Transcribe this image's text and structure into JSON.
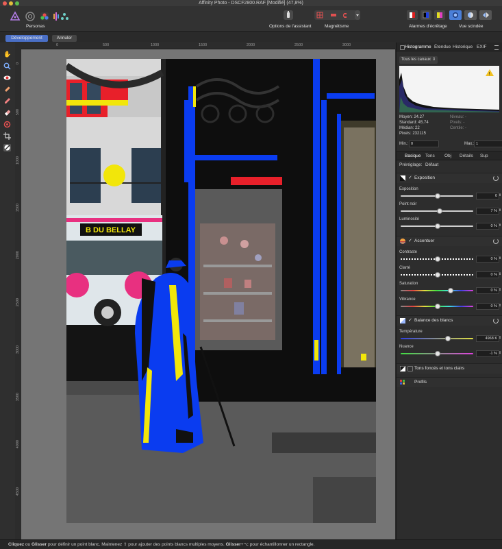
{
  "window": {
    "title": "Affinity Photo - DSCF2800.RAF [Modifié] (47,8%)"
  },
  "toolbar": {
    "personas_label": "Personas",
    "assistant_label": "Options de l'assistant",
    "snapping_label": "Magnétisme",
    "clipping_label": "Alarmes d'écrêtage",
    "split_label": "Vue scindée"
  },
  "persona_buttons": {
    "develop": "Développement",
    "cancel": "Annuler"
  },
  "ruler": {
    "h_ticks": [
      "0",
      "500",
      "1000",
      "1500",
      "2000",
      "2500",
      "3000"
    ],
    "v_ticks": [
      "0",
      "500",
      "1000",
      "1500",
      "2000",
      "2500",
      "3000",
      "3500",
      "4000",
      "4500"
    ]
  },
  "panel_tabs": [
    "Histogramme",
    "Étendue",
    "Historique",
    "EXIF"
  ],
  "histogram": {
    "channel_select": "Tous les canaux",
    "moyen": "Moyen: 24.27",
    "standard": "Standard: 45.74",
    "median": "Médian: 22",
    "pixels": "Pixels: 232115",
    "niveau": "Niveau: -",
    "pixels_r": "Pixels: -",
    "centile": "Centile: -",
    "min_label": "Min.:",
    "min_value": "0",
    "max_label": "Max.:",
    "max_value": "1"
  },
  "develop_tabs": [
    "Basique",
    "Tons",
    "Obj",
    "Détails",
    "Sup"
  ],
  "preset": {
    "label": "Préréglage:",
    "value": "Défaut"
  },
  "sections": {
    "exposure": {
      "title": "Exposition",
      "sliders": [
        {
          "label": "Exposition",
          "value": "0",
          "level": 0.5
        },
        {
          "label": "Point noir",
          "value": "7 %",
          "level": 0.53
        },
        {
          "label": "Luminosité",
          "value": "0 %",
          "level": 0.5
        }
      ]
    },
    "enhance": {
      "title": "Accentuer",
      "sliders": [
        {
          "label": "Contraste",
          "value": "0 %",
          "level": 0.5
        },
        {
          "label": "Clarté",
          "value": "0 %",
          "level": 0.5
        },
        {
          "label": "Saturation",
          "value": "0 %",
          "level": 0.68
        },
        {
          "label": "Vibrance",
          "value": "0 %",
          "level": 0.5
        }
      ]
    },
    "white_balance": {
      "title": "Balance des blancs",
      "sliders": [
        {
          "label": "Température",
          "value": "4968 K",
          "level": 0.64
        },
        {
          "label": "Nuance",
          "value": "-1 %",
          "level": 0.5
        }
      ]
    },
    "shadows_highlights": {
      "title": "Tons foncés et tons clairs"
    },
    "profiles": {
      "title": "Profils"
    }
  },
  "photo_sign": "B DU BELLAY",
  "status": {
    "b1": "Cliquez",
    "t1": " ou ",
    "b2": "Glisser",
    "t2": " pour définir un point blanc. Maintenez ",
    "t3": " pour ajouter des points blancs multiples moyens. ",
    "b3": "Glisser",
    "t4": "+⌥ pour échantillonner un rectangle."
  },
  "colors": {
    "clip_blue": "#0a3cf0",
    "clip_yellow": "#f2e60a",
    "accent": "#4a7fd8"
  }
}
